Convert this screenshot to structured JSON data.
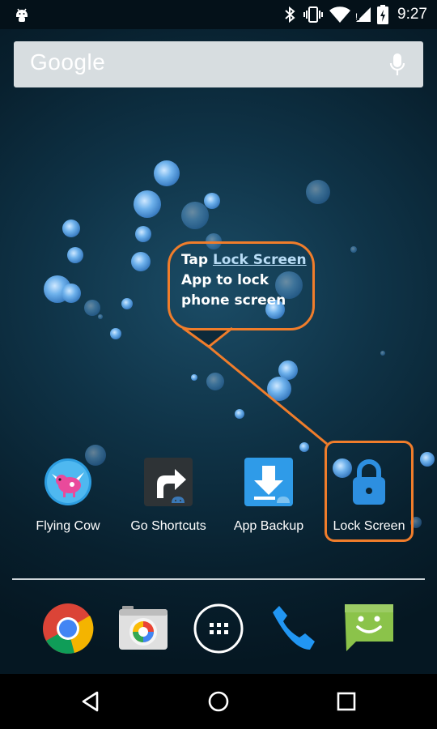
{
  "status_bar": {
    "time": "9:27",
    "icons": [
      "android-debug-icon",
      "bluetooth-icon",
      "vibrate-icon",
      "wifi-icon",
      "signal-icon",
      "battery-charging-icon"
    ]
  },
  "search_widget": {
    "logo_text": "Google",
    "mic_icon": "mic-icon"
  },
  "callout": {
    "prefix": "Tap ",
    "link_text": "Lock Screen",
    "line2": "App to lock",
    "line3": "phone screen",
    "border_color": "#f07d2b"
  },
  "apps": [
    {
      "label": "Flying Cow",
      "icon": "flying-cow-icon"
    },
    {
      "label": "Go Shortcuts",
      "icon": "go-shortcuts-icon"
    },
    {
      "label": "App Backup",
      "icon": "app-backup-icon"
    },
    {
      "label": "Lock Screen",
      "icon": "lock-icon"
    }
  ],
  "dock": [
    "chrome-icon",
    "camera-icon",
    "app-drawer-icon",
    "phone-icon",
    "messaging-icon"
  ],
  "nav": [
    "back-icon",
    "home-icon",
    "recents-icon"
  ]
}
